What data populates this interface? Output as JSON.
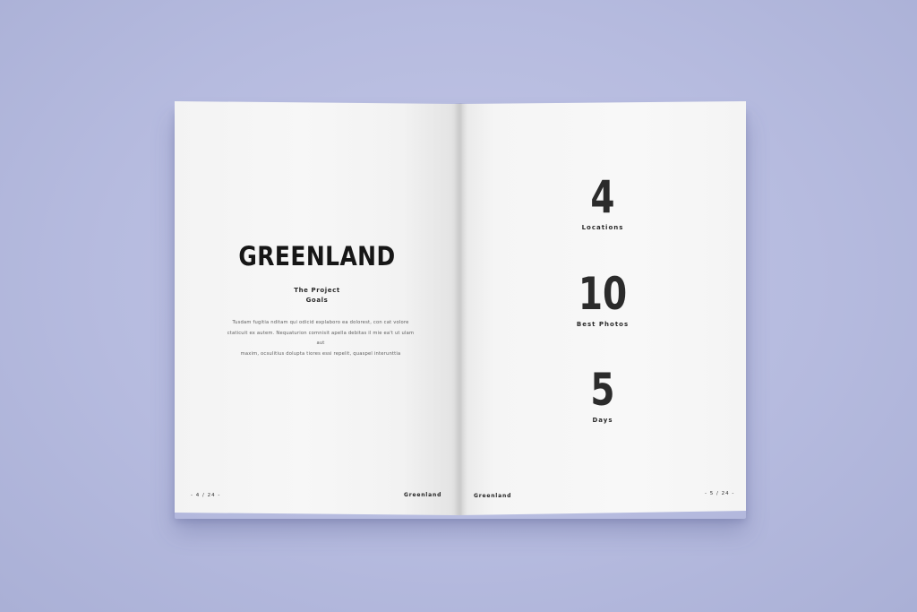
{
  "left_page": {
    "title": "GREENLAND",
    "subtitle_line1": "The Project",
    "subtitle_line2": "Goals",
    "body_lines": [
      "Tusdam fugitia nditam qui odicid explaboro ea dolorest, con cat volore",
      "ctaticuit ex autem. Nequaturion comnisit apella debitas il mie ea't ut ulam aut",
      "maxim, ocsulitius dolupta tiores essi repelit, quaspel interunttia"
    ],
    "folio": "- 4 / 24 -",
    "running_head": "Greenland"
  },
  "right_page": {
    "running_head": "Greenland",
    "folio": "- 5 / 24 -",
    "stats": [
      {
        "value": "4",
        "label": "Locations"
      },
      {
        "value": "10",
        "label": "Best Photos"
      },
      {
        "value": "5",
        "label": "Days"
      }
    ]
  }
}
